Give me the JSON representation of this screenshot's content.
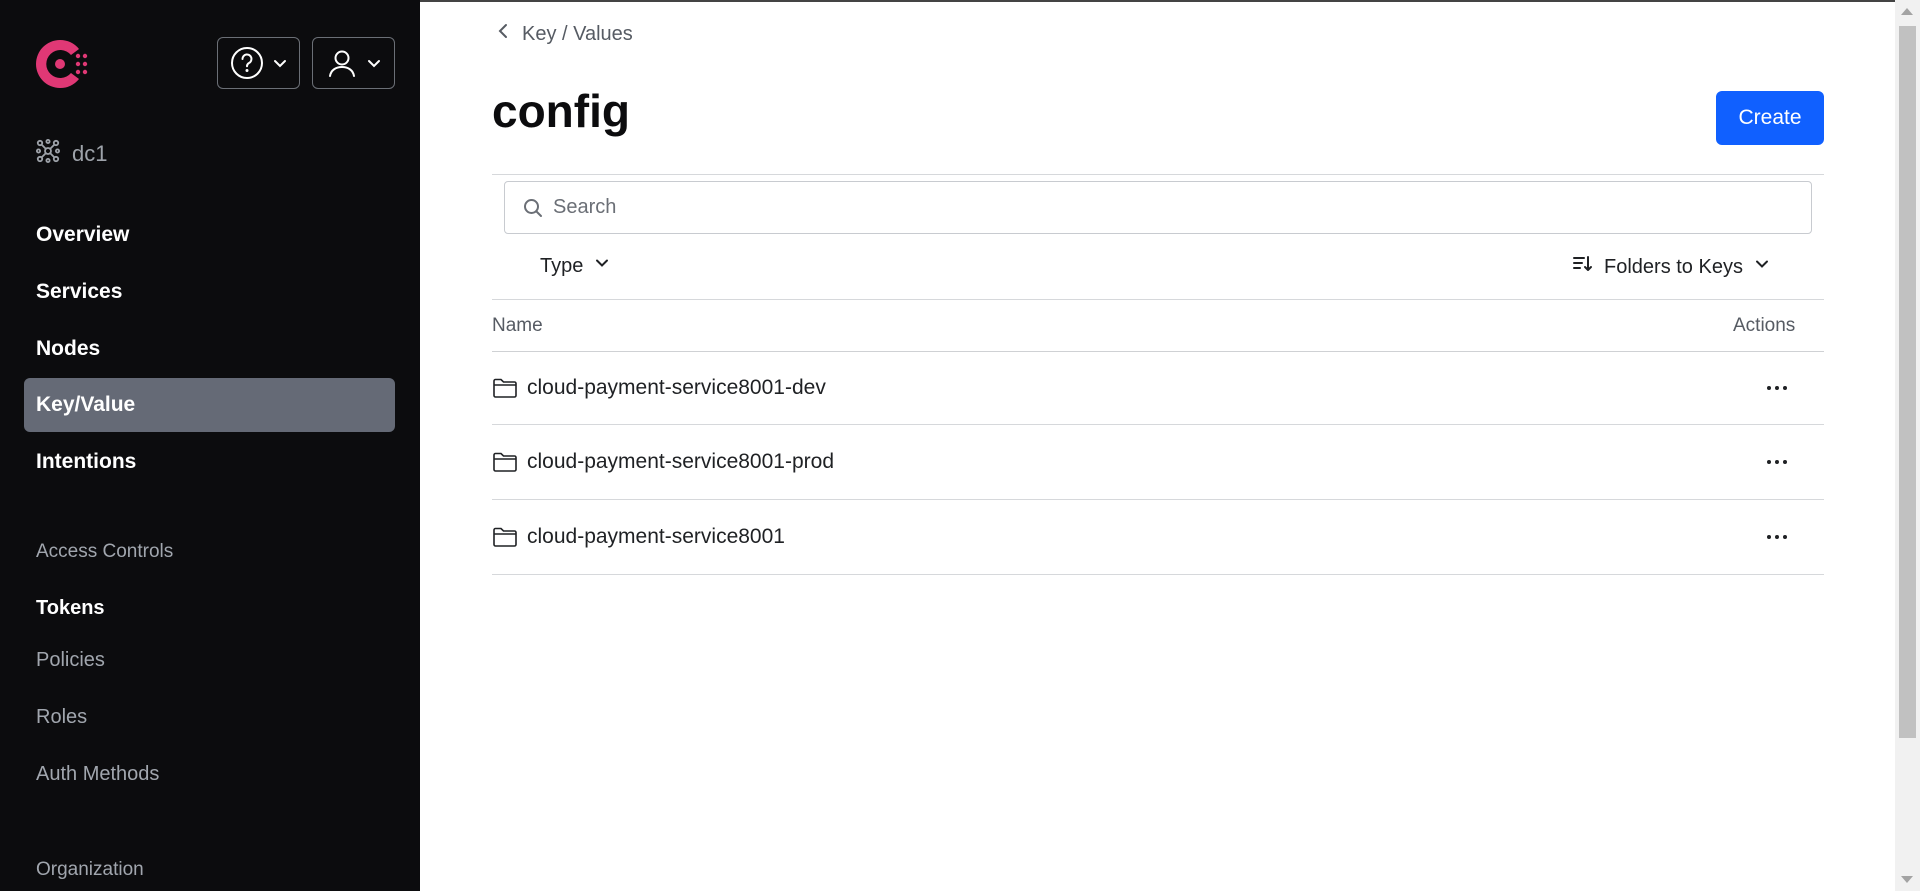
{
  "sidebar": {
    "datacenter": "dc1",
    "nav": [
      {
        "label": "Overview",
        "active": false
      },
      {
        "label": "Services",
        "active": false
      },
      {
        "label": "Nodes",
        "active": false
      },
      {
        "label": "Key/Value",
        "active": true
      },
      {
        "label": "Intentions",
        "active": false
      }
    ],
    "access_controls": {
      "heading": "Access Controls",
      "items": [
        "Tokens",
        "Policies",
        "Roles",
        "Auth Methods"
      ]
    },
    "organization": {
      "heading": "Organization"
    }
  },
  "header": {
    "breadcrumb": "Key / Values",
    "title": "config",
    "create_label": "Create"
  },
  "search": {
    "placeholder": "Search",
    "value": ""
  },
  "filters": {
    "type_label": "Type",
    "sort_label": "Folders to Keys"
  },
  "table": {
    "columns": [
      "Name",
      "Actions"
    ],
    "rows": [
      {
        "name": "cloud-payment-service8001-dev",
        "kind": "folder"
      },
      {
        "name": "cloud-payment-service8001-prod",
        "kind": "folder"
      },
      {
        "name": "cloud-payment-service8001",
        "kind": "folder"
      }
    ]
  },
  "colors": {
    "sidebar_bg": "#0c0c0e",
    "active_nav": "#656a76",
    "primary": "#1060ff",
    "brand": "#e03875"
  },
  "icons": [
    "consul-logo-icon",
    "help-icon",
    "user-icon",
    "chevron-down-icon",
    "datacenter-icon",
    "chevron-left-icon",
    "search-icon",
    "sort-icon",
    "folder-icon",
    "more-horizontal-icon"
  ]
}
